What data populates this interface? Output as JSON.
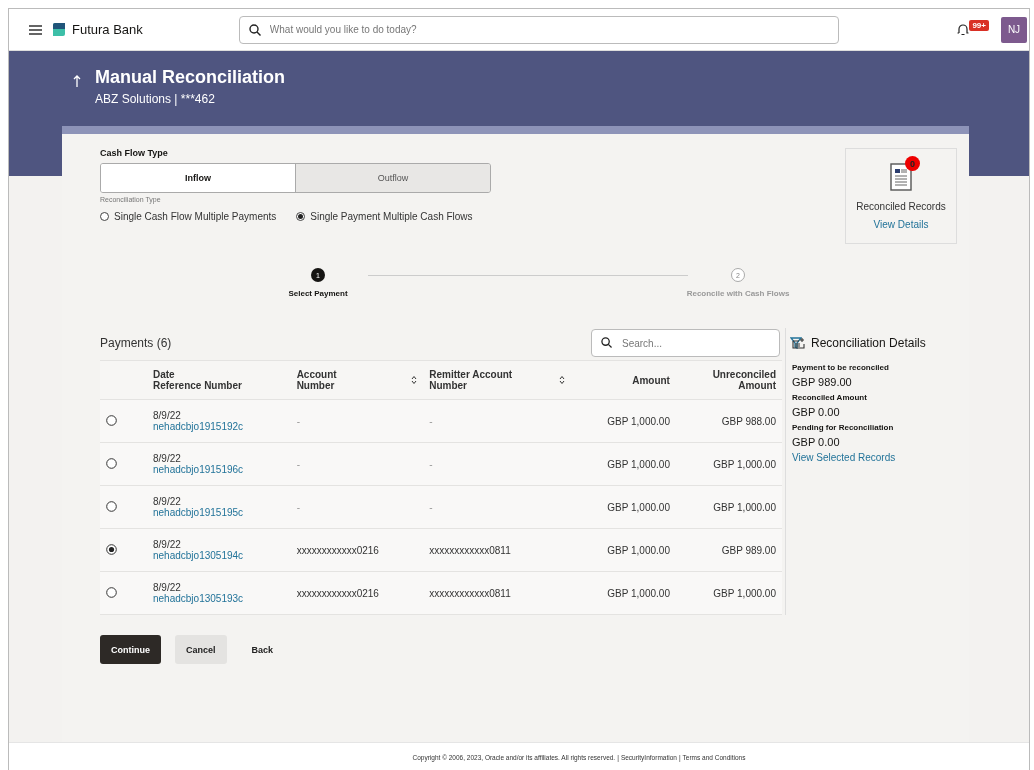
{
  "header": {
    "brand": "Futura Bank",
    "search_placeholder": "What would you like to do today?",
    "notification_badge": "99+",
    "avatar_initials": "NJ"
  },
  "page": {
    "title": "Manual Reconciliation",
    "subtitle": "ABZ Solutions | ***462"
  },
  "cash_flow_type": {
    "label": "Cash Flow Type",
    "options": [
      {
        "label": "Inflow",
        "selected": true
      },
      {
        "label": "Outflow",
        "selected": false
      }
    ]
  },
  "reconciliation_type": {
    "label": "Reconciliation Type",
    "options": [
      {
        "label": "Single Cash Flow Multiple Payments",
        "selected": false
      },
      {
        "label": "Single Payment Multiple Cash Flows",
        "selected": true
      }
    ]
  },
  "reconciled_records": {
    "badge": "0",
    "title": "Reconciled Records",
    "link": "View Details"
  },
  "steps": [
    {
      "number": "1",
      "label": "Select Payment",
      "selected": true
    },
    {
      "number": "2",
      "label": "Reconcile with Cash Flows",
      "selected": false
    }
  ],
  "payments": {
    "title": "Payments (6)",
    "search_placeholder": "Search...",
    "columns": [
      {
        "lines": [
          "Date",
          "Reference Number"
        ],
        "sortable": false
      },
      {
        "lines": [
          "Account",
          "Number"
        ],
        "sortable": true
      },
      {
        "lines": [
          "Remitter Account",
          "Number"
        ],
        "sortable": true
      },
      {
        "lines": [
          "Amount"
        ],
        "sortable": false
      },
      {
        "lines": [
          "Unreconciled",
          "Amount"
        ],
        "sortable": false
      }
    ],
    "rows": [
      {
        "selected": false,
        "date": "8/9/22",
        "reference": "nehadcbjo1915192c",
        "account": "-",
        "remitter": "-",
        "amount": "GBP 1,000.00",
        "unreconciled": "GBP 988.00"
      },
      {
        "selected": false,
        "date": "8/9/22",
        "reference": "nehadcbjo1915196c",
        "account": "-",
        "remitter": "-",
        "amount": "GBP 1,000.00",
        "unreconciled": "GBP 1,000.00"
      },
      {
        "selected": false,
        "date": "8/9/22",
        "reference": "nehadcbjo1915195c",
        "account": "-",
        "remitter": "-",
        "amount": "GBP 1,000.00",
        "unreconciled": "GBP 1,000.00"
      },
      {
        "selected": true,
        "date": "8/9/22",
        "reference": "nehadcbjo1305194c",
        "account": "xxxxxxxxxxxx0216",
        "remitter": "xxxxxxxxxxxx0811",
        "amount": "GBP 1,000.00",
        "unreconciled": "GBP 989.00"
      },
      {
        "selected": false,
        "date": "8/9/22",
        "reference": "nehadcbjo1305193c",
        "account": "xxxxxxxxxxxx0216",
        "remitter": "xxxxxxxxxxxx0811",
        "amount": "GBP 1,000.00",
        "unreconciled": "GBP 1,000.00"
      }
    ]
  },
  "details": {
    "title": "Reconciliation Details",
    "items": [
      {
        "label": "Payment to be reconciled",
        "value": "GBP 989.00"
      },
      {
        "label": "Reconciled Amount",
        "value": "GBP 0.00"
      },
      {
        "label": "Pending for Reconciliation",
        "value": "GBP 0.00"
      }
    ],
    "link": "View Selected Records"
  },
  "buttons": [
    {
      "label": "Continue",
      "kind": "primary"
    },
    {
      "label": "Cancel",
      "kind": "secondary"
    },
    {
      "label": "Back",
      "kind": "text"
    }
  ],
  "footer": {
    "copyright": "Copyright © 2006, 2023, Oracle and/or its affiliates. All rights reserved.",
    "separator": "|",
    "links": [
      "SecurityInformation",
      "Terms and Conditions"
    ]
  }
}
